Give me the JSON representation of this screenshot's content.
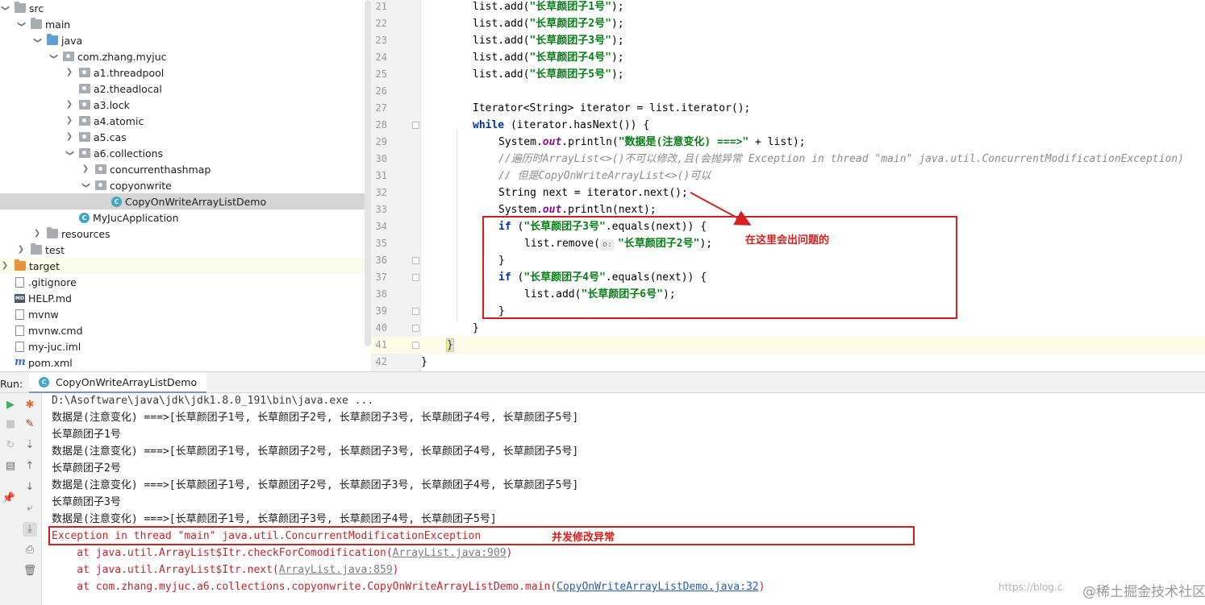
{
  "project_tree": {
    "items": [
      {
        "label": "src",
        "icon": "folder-icon"
      },
      {
        "label": "main",
        "icon": "folder-icon"
      },
      {
        "label": "java",
        "icon": "source-folder-icon"
      },
      {
        "label": "com.zhang.myjuc",
        "icon": "package-icon"
      },
      {
        "label": "a1.threadpool",
        "icon": "package-icon"
      },
      {
        "label": "a2.theadlocal",
        "icon": "package-icon"
      },
      {
        "label": "a3.lock",
        "icon": "package-icon"
      },
      {
        "label": "a4.atomic",
        "icon": "package-icon"
      },
      {
        "label": "a5.cas",
        "icon": "package-icon"
      },
      {
        "label": "a6.collections",
        "icon": "package-icon"
      },
      {
        "label": "concurrenthashmap",
        "icon": "package-icon"
      },
      {
        "label": "copyonwrite",
        "icon": "package-icon"
      },
      {
        "label": "CopyOnWriteArrayListDemo",
        "icon": "class-icon",
        "class_letter": "C"
      },
      {
        "label": "MyJucApplication",
        "icon": "class-icon",
        "class_letter": "C"
      },
      {
        "label": "resources",
        "icon": "folder-icon"
      },
      {
        "label": "test",
        "icon": "folder-icon"
      },
      {
        "label": "target",
        "icon": "folder-icon"
      },
      {
        "label": ".gitignore",
        "icon": "file-icon"
      },
      {
        "label": "HELP.md",
        "icon": "markdown-icon",
        "badge": "MD"
      },
      {
        "label": "mvnw",
        "icon": "file-icon"
      },
      {
        "label": "mvnw.cmd",
        "icon": "file-icon"
      },
      {
        "label": "my-juc.iml",
        "icon": "file-icon"
      },
      {
        "label": "pom.xml",
        "icon": "maven-icon",
        "badge": "m"
      }
    ]
  },
  "editor": {
    "line_numbers": [
      "21",
      "22",
      "23",
      "24",
      "25",
      "26",
      "27",
      "28",
      "29",
      "30",
      "31",
      "32",
      "33",
      "34",
      "35",
      "36",
      "37",
      "38",
      "39",
      "40",
      "41",
      "42"
    ],
    "lines": [
      [
        {
          "t": "list.add(",
          "c": ""
        },
        {
          "t": "\"长草颜团子1号\"",
          "c": "str"
        },
        {
          "t": ");",
          "c": ""
        }
      ],
      [
        {
          "t": "list.add(",
          "c": ""
        },
        {
          "t": "\"长草颜团子2号\"",
          "c": "str"
        },
        {
          "t": ");",
          "c": ""
        }
      ],
      [
        {
          "t": "list.add(",
          "c": ""
        },
        {
          "t": "\"长草颜团子3号\"",
          "c": "str"
        },
        {
          "t": ");",
          "c": ""
        }
      ],
      [
        {
          "t": "list.add(",
          "c": ""
        },
        {
          "t": "\"长草颜团子4号\"",
          "c": "str"
        },
        {
          "t": ");",
          "c": ""
        }
      ],
      [
        {
          "t": "list.add(",
          "c": ""
        },
        {
          "t": "\"长草颜团子5号\"",
          "c": "str"
        },
        {
          "t": ");",
          "c": ""
        }
      ],
      [],
      [
        {
          "t": "Iterator<String> iterator = list.iterator();",
          "c": ""
        }
      ],
      [
        {
          "t": "while",
          "c": "kw"
        },
        {
          "t": " (iterator.hasNext()) {",
          "c": ""
        }
      ],
      [
        {
          "t": "System.",
          "c": ""
        },
        {
          "t": "out",
          "c": "fld"
        },
        {
          "t": ".println(",
          "c": ""
        },
        {
          "t": "\"数据是(注意变化) ===>\"",
          "c": "str"
        },
        {
          "t": " + list);",
          "c": ""
        }
      ],
      [
        {
          "t": "//遍历时ArrayList<>()不可以修改,且(会抛异常 Exception in thread \"main\" java.util.ConcurrentModificationException)",
          "c": "cmt"
        }
      ],
      [
        {
          "t": "// 但是CopyOnWriteArrayList<>()可以",
          "c": "cmt"
        }
      ],
      [
        {
          "t": "String next = iterator.next();",
          "c": ""
        }
      ],
      [
        {
          "t": "System.",
          "c": ""
        },
        {
          "t": "out",
          "c": "fld"
        },
        {
          "t": ".println(next);",
          "c": ""
        }
      ],
      [
        {
          "t": "if",
          "c": "kw"
        },
        {
          "t": " (",
          "c": ""
        },
        {
          "t": "\"长草颜团子3号\"",
          "c": "str"
        },
        {
          "t": ".equals(next)) {",
          "c": ""
        }
      ],
      [
        {
          "t": "list.remove(",
          "c": ""
        },
        {
          "t": "o:",
          "c": "hint"
        },
        {
          "t": "\"长草颜团子2号\"",
          "c": "str"
        },
        {
          "t": ");",
          "c": ""
        }
      ],
      [
        {
          "t": "}",
          "c": ""
        }
      ],
      [
        {
          "t": "if",
          "c": "kw"
        },
        {
          "t": " (",
          "c": ""
        },
        {
          "t": "\"长草颜团子4号\"",
          "c": "str"
        },
        {
          "t": ".equals(next)) {",
          "c": ""
        }
      ],
      [
        {
          "t": "list.add(",
          "c": ""
        },
        {
          "t": "\"长草颜团子6号\"",
          "c": "str"
        },
        {
          "t": ");",
          "c": ""
        }
      ],
      [
        {
          "t": "}",
          "c": ""
        }
      ],
      [
        {
          "t": "}",
          "c": ""
        }
      ],
      [
        {
          "t": "}",
          "c": "brace"
        }
      ],
      [
        {
          "t": "}",
          "c": ""
        }
      ]
    ],
    "annotation": "在这里会出问题的"
  },
  "run_panel": {
    "label": "Run:",
    "tab_label": "CopyOnWriteArrayListDemo",
    "toolbar_icons": [
      "run-icon",
      "stop-icon",
      "rerun-icon",
      "layout-icon",
      "pin-icon",
      "debug-icon",
      "edit-config-icon",
      "sort-icon",
      "up-arrow-icon",
      "down-arrow-icon",
      "soft-wrap-icon",
      "scroll-to-end-icon",
      "print-icon",
      "trash-icon"
    ],
    "console_lines": [
      {
        "text": "D:\\Asoftware\\java\\jdk\\jdk1.8.0_191\\bin\\java.exe ...",
        "kind": "gray"
      },
      {
        "text": "数据是(注意变化) ===>[长草颜团子1号, 长草颜团子2号, 长草颜团子3号, 长草颜团子4号, 长草颜团子5号]",
        "kind": "out"
      },
      {
        "text": "长草颜团子1号",
        "kind": "out"
      },
      {
        "text": "数据是(注意变化) ===>[长草颜团子1号, 长草颜团子2号, 长草颜团子3号, 长草颜团子4号, 长草颜团子5号]",
        "kind": "out"
      },
      {
        "text": "长草颜团子2号",
        "kind": "out"
      },
      {
        "text": "数据是(注意变化) ===>[长草颜团子1号, 长草颜团子2号, 长草颜团子3号, 长草颜团子4号, 长草颜团子5号]",
        "kind": "out"
      },
      {
        "text": "长草颜团子3号",
        "kind": "out"
      },
      {
        "text": "数据是(注意变化) ===>[长草颜团子1号, 长草颜团子3号, 长草颜团子4号, 长草颜团子5号]",
        "kind": "out"
      },
      {
        "text": "Exception in thread \"main\" java.util.ConcurrentModificationException",
        "kind": "err"
      }
    ],
    "stack_trace": [
      {
        "prefix": "    at java.util.ArrayList$Itr.checkForComodification(",
        "link": "ArrayList.java:909",
        "suffix": ")",
        "link_style": "faint"
      },
      {
        "prefix": "    at java.util.ArrayList$Itr.next(",
        "link": "ArrayList.java:859",
        "suffix": ")",
        "link_style": "faint"
      },
      {
        "prefix": "    at com.zhang.myjuc.a6.collections.copyonwrite.CopyOnWriteArrayListDemo.main(",
        "link": "CopyOnWriteArrayListDemo.java:32",
        "suffix": ")",
        "link_style": "link"
      }
    ],
    "annotation": "并发修改异常"
  },
  "watermark": {
    "url_text": "https://blog.c",
    "brand_text": "@稀土掘金技术社区"
  },
  "colors": {
    "annotation_red": "#d61f1f",
    "string_green": "#067d17",
    "keyword_blue": "#0033b3",
    "field_purple": "#871094",
    "error_red": "#c0272d",
    "selection_gray": "#d5d5d5"
  }
}
